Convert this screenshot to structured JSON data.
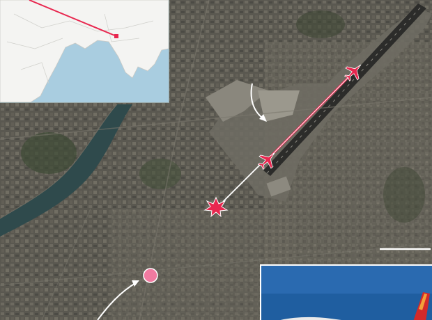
{
  "map": {
    "view": "satellite",
    "colors": {
      "route_red": "#e8274f",
      "marker_pink": "#f07aa0",
      "annotation_white": "#ffffff",
      "river": "#2f4a4c",
      "terrain": "#4a4942",
      "ocean": "#a9cde0",
      "land": "#f4f4f2"
    },
    "icons": [
      "airplane-icon",
      "crash-burst-icon",
      "location-dot-icon",
      "route-line-icon",
      "scale-bar-icon",
      "curved-arrow-icon"
    ]
  },
  "inset_map": {
    "type": "locator",
    "icons": [
      "origin-marker-icon",
      "route-line-icon"
    ]
  },
  "photo_inset": {
    "subject": "aircraft",
    "icons": [
      "aircraft-photo-icon"
    ]
  }
}
